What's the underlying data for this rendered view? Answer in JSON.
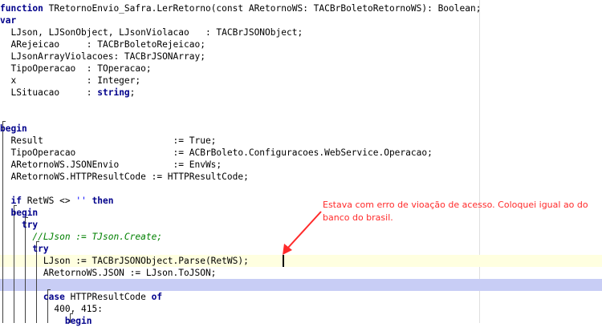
{
  "code_lines": [
    {
      "kw": "function ",
      "text": "TRetornoEnvio_Safra.LerRetorno(const ARetornoWS: TACBrBoletoRetornoWS): Boolean;"
    },
    {
      "kw": "var",
      "text": ""
    },
    {
      "kw": "",
      "text": "  LJson, LJSonObject, LJsonViolacao   : TACBrJSONObject;"
    },
    {
      "kw": "",
      "text": "  ARejeicao     : TACBrBoletoRejeicao;"
    },
    {
      "kw": "",
      "text": "  LJsonArrayViolacoes: TACBrJSONArray;"
    },
    {
      "kw": "",
      "text": "  TipoOperacao  : TOperacao;"
    },
    {
      "kw": "",
      "text": "  x             : Integer;"
    },
    {
      "pre": "  LSituacao     : ",
      "kw": "string",
      "text": ";"
    },
    {
      "kw": "",
      "text": ""
    },
    {
      "kw": "begin",
      "text": ""
    },
    {
      "kw": "",
      "text": "  Result                        := True;"
    },
    {
      "kw": "",
      "text": "  TipoOperacao                  := ACBrBoleto.Configuracoes.WebService.Operacao;"
    },
    {
      "kw": "",
      "text": "  ARetornoWS.JSONEnvio          := EnvWs;"
    },
    {
      "kw": "",
      "text": "  ARetornoWS.HTTPResultCode := HTTPResultCode;"
    },
    {
      "kw": "",
      "text": ""
    },
    {
      "pre": "  ",
      "kw": "if",
      "text": " RetWS <> ",
      "str": "''",
      "post": " ",
      "kw2": "then"
    },
    {
      "pre": "  ",
      "kw": "begin",
      "text": ""
    },
    {
      "pre": "    ",
      "kw": "try",
      "text": ""
    },
    {
      "pre": "      ",
      "comment": "//LJson := TJson.Create;"
    },
    {
      "pre": "      ",
      "kw": "try",
      "text": ""
    },
    {
      "kw": "",
      "text": "        LJson := TACBrJSONObject.Parse(RetWS);"
    },
    {
      "kw": "",
      "text": "        ARetornoWS.JSON := LJson.ToJSON;"
    },
    {
      "kw": "",
      "text": ""
    },
    {
      "pre": "        ",
      "kw": "case",
      "text": " HTTPResultCode ",
      "kw2": "of"
    },
    {
      "kw": "",
      "text": "          400, 415:"
    },
    {
      "pre": "            ",
      "kw": "begin",
      "text": ""
    }
  ],
  "annotation": {
    "text": "Estava com erro de vioação de acesso. Coloquei igual ao do banco do brasil."
  },
  "colors": {
    "keyword": "#00008b",
    "comment": "#008000",
    "string": "#0000ff",
    "annotation": "#ff2a2a",
    "current_line": "#ffffe0",
    "selected_line": "#c8cdf5"
  }
}
